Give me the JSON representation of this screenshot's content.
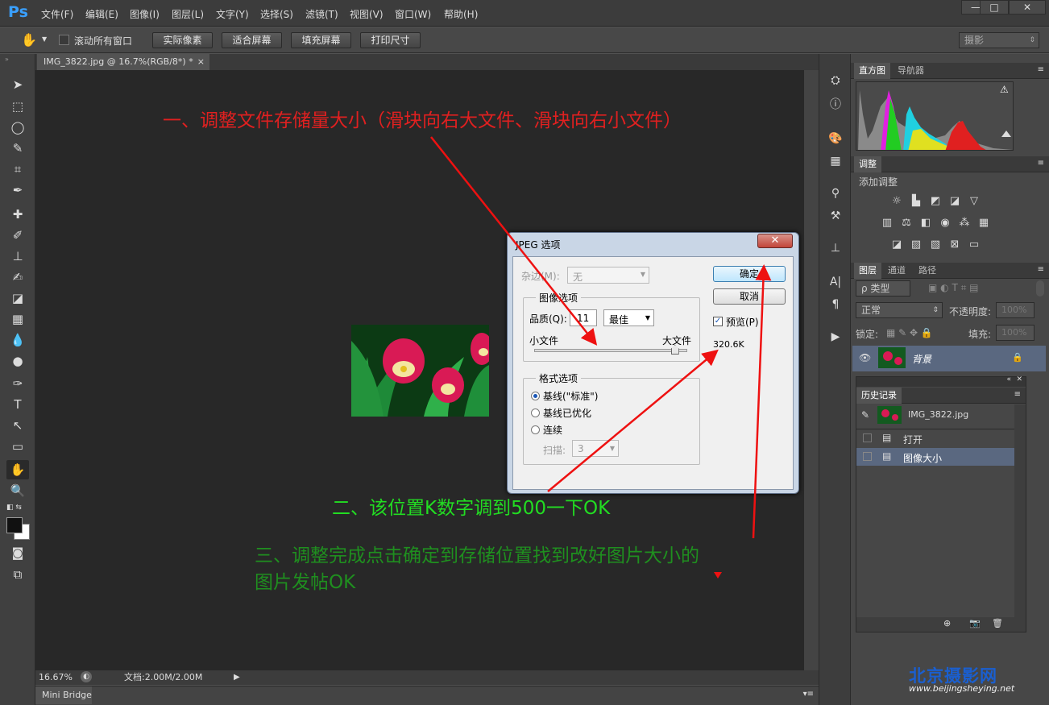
{
  "app": {
    "logo": "Ps"
  },
  "menu": [
    "文件(F)",
    "编辑(E)",
    "图像(I)",
    "图层(L)",
    "文字(Y)",
    "选择(S)",
    "滤镜(T)",
    "视图(V)",
    "窗口(W)",
    "帮助(H)"
  ],
  "window_controls": [
    "—",
    "□",
    "✕"
  ],
  "options_bar": {
    "scroll_all_label": "滚动所有窗口",
    "buttons": [
      "实际像素",
      "适合屏幕",
      "填充屏幕",
      "打印尺寸"
    ],
    "workspace": "摄影"
  },
  "document": {
    "tab_title": "IMG_3822.jpg @ 16.7%(RGB/8*) *",
    "tab_close": "×",
    "zoom": "16.67%",
    "doc_size": "文档:2.00M/2.00M"
  },
  "minibridge": {
    "label": "Mini Bridge"
  },
  "panels": {
    "histogram_tabs": [
      "直方图",
      "导航器"
    ],
    "adjustments_tab": "调整",
    "adjustments_title": "添加调整",
    "layers_tabs": [
      "图层",
      "通道",
      "路径"
    ],
    "kind_filter": "ρ 类型",
    "blend_mode": "正常",
    "opacity_label": "不透明度:",
    "opacity_value": "100%",
    "lock_label": "锁定:",
    "fill_label": "填充:",
    "fill_value": "100%",
    "layer_name": "背景",
    "history_tab": "历史记录",
    "history_snapshot": "IMG_3822.jpg",
    "history_items": [
      "打开",
      "图像大小"
    ]
  },
  "dialog": {
    "title": "JPEG 选项",
    "close": "✕",
    "matte_label": "杂边(M):",
    "matte_value": "无",
    "image_options_group": "图像选项",
    "quality_label": "品质(Q):",
    "quality_value": "11",
    "quality_preset": "最佳",
    "small_file": "小文件",
    "large_file": "大文件",
    "quality_slider_fraction": 0.92,
    "format_group": "格式选项",
    "formats": [
      "基线(\"标准\")",
      "基线已优化",
      "连续"
    ],
    "scans_label": "扫描:",
    "scans_value": "3",
    "ok": "确定",
    "cancel": "取消",
    "preview_label": "预览(P)",
    "file_size": "320.6K"
  },
  "annotations": {
    "step1": "一、调整文件存储量大小（滑块向右大文件、滑块向右小文件）",
    "step2": "二、该位置K数字调到500一下OK",
    "step3_line1": "三、调整完成点击确定到存储位置找到改好图片大小的",
    "step3_line2": "图片发帖OK",
    "watermark_cn": "北京摄影网",
    "watermark_url": "www.beijingsheying.net"
  },
  "colors": {
    "arrow_red": "#ee1111",
    "annotation_red": "#e02020",
    "annotation_green": "#22dd22",
    "annotation_dark_green": "#1f8f1f",
    "accent_blue": "#3aa0ff"
  }
}
